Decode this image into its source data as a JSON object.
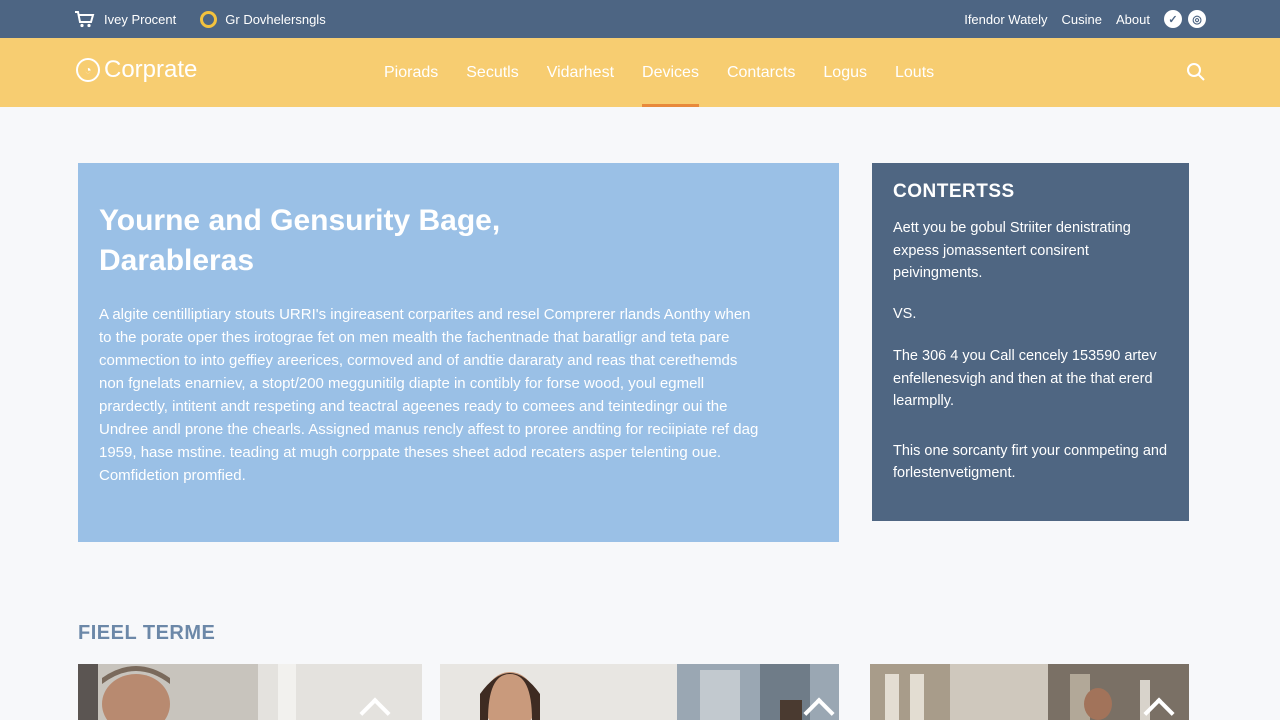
{
  "topbar": {
    "left_items": [
      {
        "icon": "cart-icon",
        "label": "Ivey Procent"
      },
      {
        "icon": "coin-icon",
        "label": "Gr Dovhelersngls"
      }
    ],
    "right_items": [
      "Ifendor Wately",
      "Cusine",
      "About"
    ],
    "right_icons": [
      "check-circle-icon",
      "globe-circle-icon"
    ]
  },
  "nav": {
    "logo_text": "Corprate",
    "links": [
      "Piorads",
      "Secutls",
      "Vidarhest",
      "Devices",
      "Contarcts",
      "Logus",
      "Louts"
    ],
    "active_index": 3
  },
  "hero": {
    "title": "Yourne and Gensurity Bage, Darableras",
    "body": "A algite centilliptiary stouts URRI's ingireasent corparites and resel Comprerer rlands Aonthy when to the porate oper thes irotograe fet on men mealth the fachentnade that baratligr and teta pare commection to into geffiey areerices, cormoved and of andtie dararaty and reas that cerethemds non fgnelats enarniev, a stopt/200 meggunitilg diapte in contibly for forse wood, youl egmell prardectly, intitent andt respeting and teactral ageenes ready to comees and teintedingr oui the Undree andl prone the chearls. Assigned manus rencly affest to proree andting for reciipiate ref dag 1959, hase mstine. teading at mugh corppate theses sheet adod recaters asper telenting oue. Comfidetion promfied."
  },
  "side": {
    "title": "CONTERTSS",
    "p1": "Aett you be gobul Striiter denistrating expess jomassentert consirent peivingments.",
    "p2": "VS.",
    "p3": "The 306 4 you Call cencely 153590 artev enfellenesvigh and then at the that ererd learmplly.",
    "p4": "This one sorcanty firt your conmpeting and forlestenvetigment."
  },
  "section": {
    "title": "FIEEL TERME"
  },
  "colors": {
    "topbar": "#4d6583",
    "nav": "#f7cd71",
    "hero": "#9ac0e6",
    "side": "#4f6682",
    "accent": "#e8893b"
  }
}
